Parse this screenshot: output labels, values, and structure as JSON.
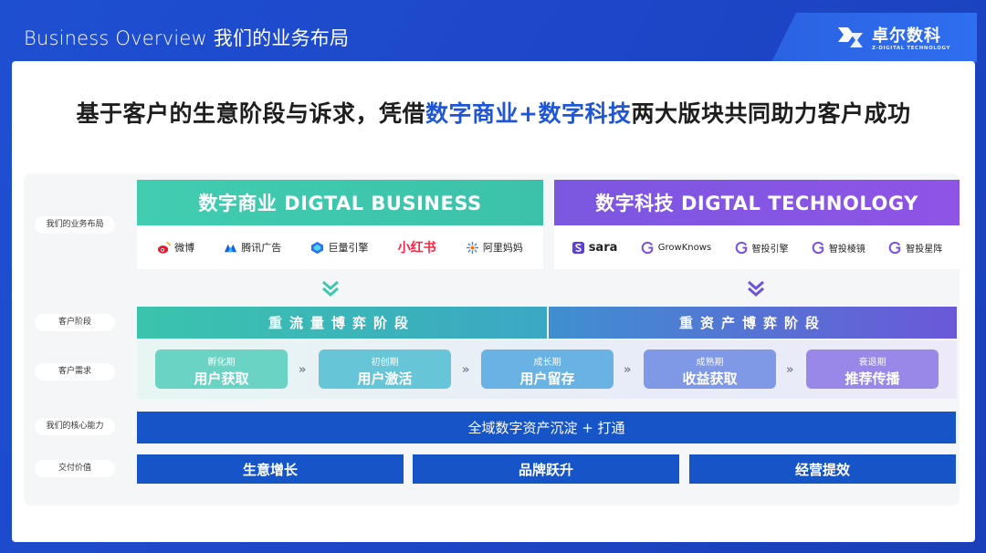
{
  "header": {
    "title": "Business Overview  我们的业务布局"
  },
  "brand": {
    "name": "卓尔数科",
    "tagline": "Z-DIGITAL TECHNOLOGY"
  },
  "headline": {
    "pre": "基于客户的生意阶段与诉求，凭借",
    "highlight": "数字商业+数字科技",
    "post": "两大版块共同助力客户成功"
  },
  "row_labels": [
    "我们的业务布局",
    "客户阶段",
    "客户需求",
    "我们的核心能力",
    "交付价值"
  ],
  "business": {
    "title": "数字商业  DIGTAL BUSINESS",
    "color": "#3ec9ad",
    "partners": [
      {
        "name": "微博",
        "icon": "weibo-icon"
      },
      {
        "name": "腾讯广告",
        "icon": "tencent-ads-icon"
      },
      {
        "name": "巨量引擎",
        "icon": "ocean-engine-icon"
      },
      {
        "name": "小红书",
        "icon": ""
      },
      {
        "name": "阿里妈妈",
        "icon": "alimama-icon"
      }
    ]
  },
  "technology": {
    "title": "数字科技  DIGTAL TECHNOLOGY",
    "color": "#8b55e3",
    "products": [
      {
        "name": "sara",
        "icon": "sara-icon"
      },
      {
        "name": "GrowKnows",
        "icon": "growknows-icon"
      },
      {
        "name": "智投引擎",
        "icon": "zhitou-engine-icon"
      },
      {
        "name": "智投棱镜",
        "icon": "zhitou-prism-icon"
      },
      {
        "name": "智投星阵",
        "icon": "zhitou-star-icon"
      }
    ]
  },
  "stages": [
    "重流量博弈阶段",
    "重资产博弈阶段"
  ],
  "needs": [
    {
      "phase": "孵化期",
      "need": "用户获取"
    },
    {
      "phase": "初创期",
      "need": "用户激活"
    },
    {
      "phase": "成长期",
      "need": "用户留存"
    },
    {
      "phase": "成熟期",
      "need": "收益获取"
    },
    {
      "phase": "衰退期",
      "need": "推荐传播"
    }
  ],
  "need_separator": "»",
  "core": "全域数字资产沉淀 + 打通",
  "values": [
    "生意增长",
    "品牌跃升",
    "经营提效"
  ]
}
